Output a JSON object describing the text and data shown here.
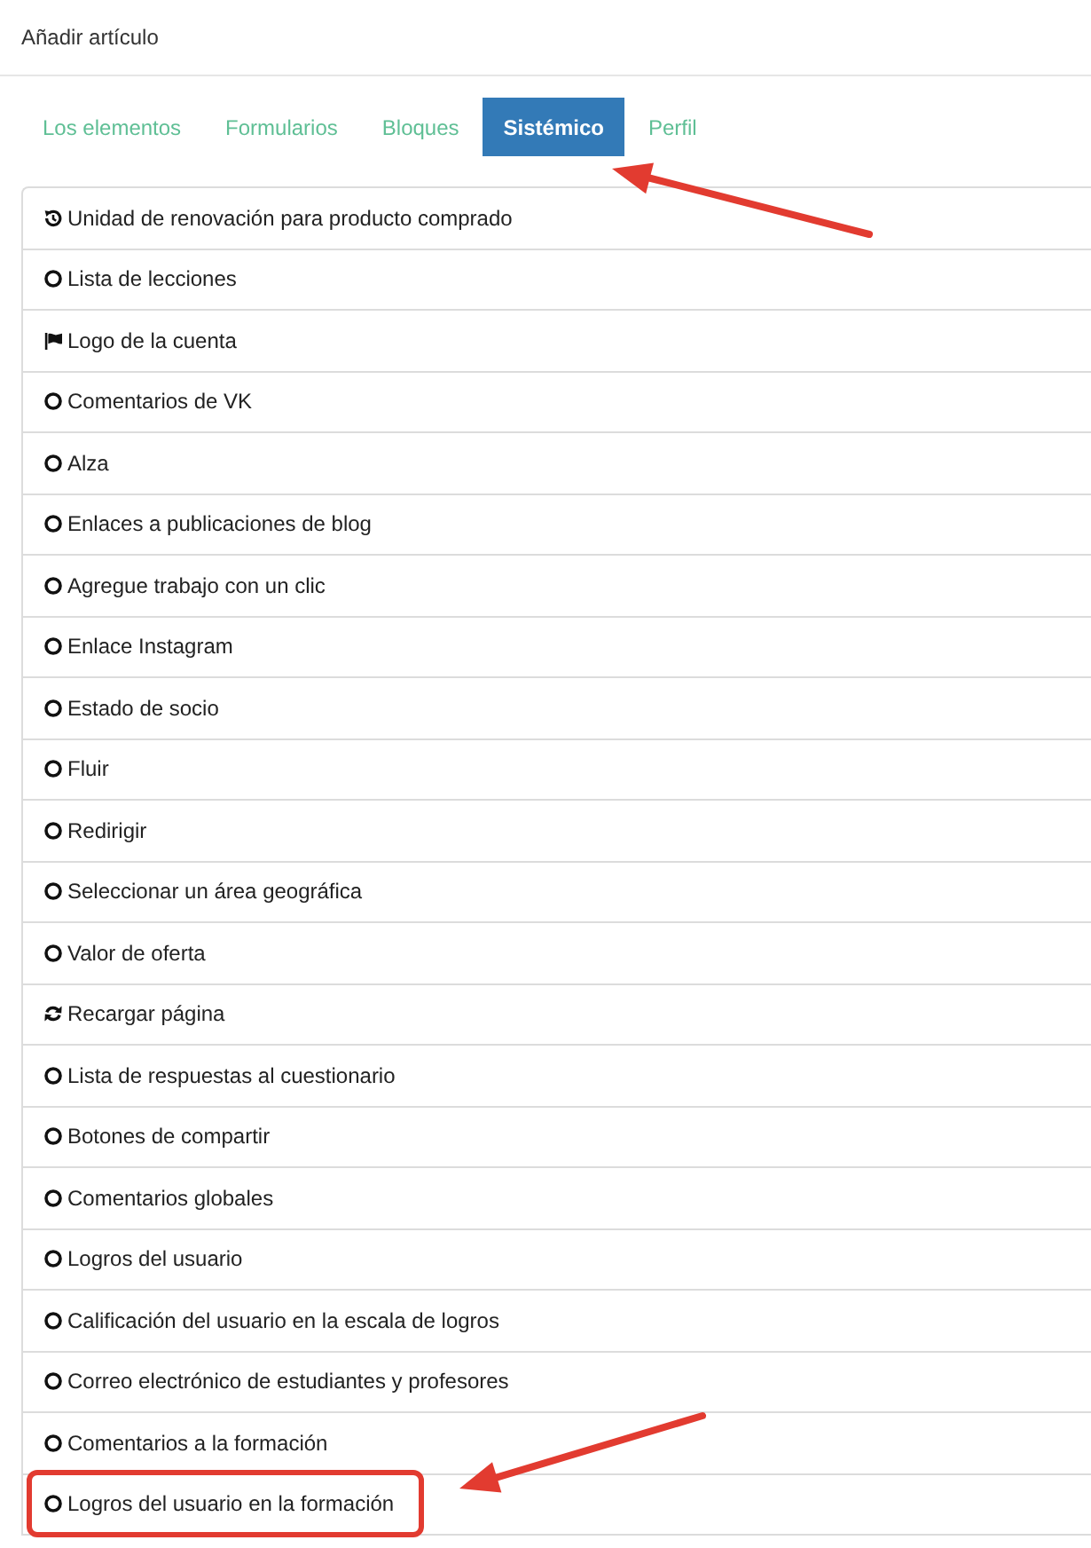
{
  "header": {
    "title": "Añadir artículo"
  },
  "tabs": [
    {
      "label": "Los elementos",
      "selected": false
    },
    {
      "label": "Formularios",
      "selected": false
    },
    {
      "label": "Bloques",
      "selected": false
    },
    {
      "label": "Sistémico",
      "selected": true
    },
    {
      "label": "Perfil",
      "selected": false
    }
  ],
  "items": [
    {
      "kind": "history",
      "label": "Unidad de renovación para producto comprado"
    },
    {
      "kind": "circle",
      "label": "Lista de lecciones"
    },
    {
      "kind": "flag",
      "label": "Logo de la cuenta"
    },
    {
      "kind": "circle",
      "label": "Comentarios de VK"
    },
    {
      "kind": "circle",
      "label": "Alza"
    },
    {
      "kind": "circle",
      "label": "Enlaces a publicaciones de blog"
    },
    {
      "kind": "circle",
      "label": "Agregue trabajo con un clic"
    },
    {
      "kind": "circle",
      "label": "Enlace Instagram"
    },
    {
      "kind": "circle",
      "label": "Estado de socio"
    },
    {
      "kind": "circle",
      "label": "Fluir"
    },
    {
      "kind": "circle",
      "label": "Redirigir"
    },
    {
      "kind": "circle",
      "label": "Seleccionar un área geográfica"
    },
    {
      "kind": "circle",
      "label": "Valor de oferta"
    },
    {
      "kind": "refresh",
      "label": "Recargar página"
    },
    {
      "kind": "circle",
      "label": "Lista de respuestas al cuestionario"
    },
    {
      "kind": "circle",
      "label": "Botones de compartir"
    },
    {
      "kind": "circle",
      "label": "Comentarios globales"
    },
    {
      "kind": "circle",
      "label": "Logros del usuario"
    },
    {
      "kind": "circle",
      "label": "Calificación del usuario en la escala de logros"
    },
    {
      "kind": "circle",
      "label": "Correo electrónico de estudiantes y profesores"
    },
    {
      "kind": "circle",
      "label": "Comentarios a la formación"
    },
    {
      "kind": "circle",
      "label": "Logros del usuario en la formación"
    }
  ],
  "annotations": [
    {
      "kind": "arrow"
    },
    {
      "kind": "arrow"
    },
    {
      "kind": "frame"
    }
  ]
}
